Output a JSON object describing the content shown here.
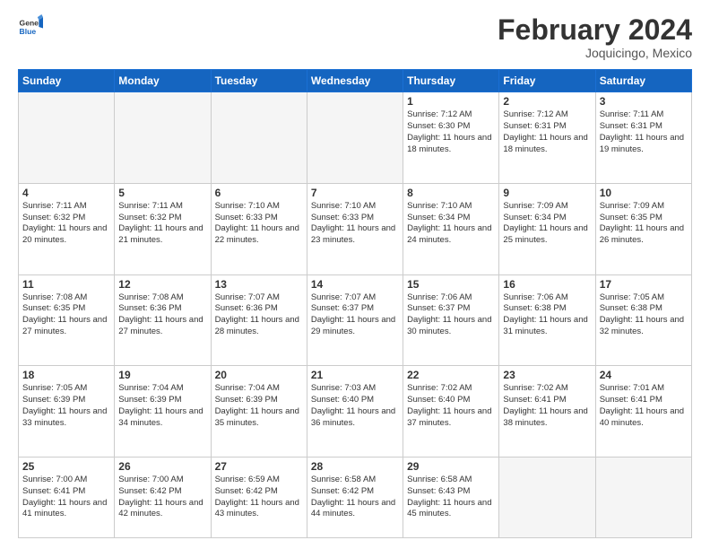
{
  "header": {
    "logo_general": "General",
    "logo_blue": "Blue",
    "month_title": "February 2024",
    "location": "Joquicingo, Mexico"
  },
  "days_of_week": [
    "Sunday",
    "Monday",
    "Tuesday",
    "Wednesday",
    "Thursday",
    "Friday",
    "Saturday"
  ],
  "weeks": [
    [
      {
        "day": "",
        "empty": true
      },
      {
        "day": "",
        "empty": true
      },
      {
        "day": "",
        "empty": true
      },
      {
        "day": "",
        "empty": true
      },
      {
        "day": "1",
        "sunrise": "7:12 AM",
        "sunset": "6:30 PM",
        "daylight": "11 hours and 18 minutes."
      },
      {
        "day": "2",
        "sunrise": "7:12 AM",
        "sunset": "6:31 PM",
        "daylight": "11 hours and 18 minutes."
      },
      {
        "day": "3",
        "sunrise": "7:11 AM",
        "sunset": "6:31 PM",
        "daylight": "11 hours and 19 minutes."
      }
    ],
    [
      {
        "day": "4",
        "sunrise": "7:11 AM",
        "sunset": "6:32 PM",
        "daylight": "11 hours and 20 minutes."
      },
      {
        "day": "5",
        "sunrise": "7:11 AM",
        "sunset": "6:32 PM",
        "daylight": "11 hours and 21 minutes."
      },
      {
        "day": "6",
        "sunrise": "7:10 AM",
        "sunset": "6:33 PM",
        "daylight": "11 hours and 22 minutes."
      },
      {
        "day": "7",
        "sunrise": "7:10 AM",
        "sunset": "6:33 PM",
        "daylight": "11 hours and 23 minutes."
      },
      {
        "day": "8",
        "sunrise": "7:10 AM",
        "sunset": "6:34 PM",
        "daylight": "11 hours and 24 minutes."
      },
      {
        "day": "9",
        "sunrise": "7:09 AM",
        "sunset": "6:34 PM",
        "daylight": "11 hours and 25 minutes."
      },
      {
        "day": "10",
        "sunrise": "7:09 AM",
        "sunset": "6:35 PM",
        "daylight": "11 hours and 26 minutes."
      }
    ],
    [
      {
        "day": "11",
        "sunrise": "7:08 AM",
        "sunset": "6:35 PM",
        "daylight": "11 hours and 27 minutes."
      },
      {
        "day": "12",
        "sunrise": "7:08 AM",
        "sunset": "6:36 PM",
        "daylight": "11 hours and 27 minutes."
      },
      {
        "day": "13",
        "sunrise": "7:07 AM",
        "sunset": "6:36 PM",
        "daylight": "11 hours and 28 minutes."
      },
      {
        "day": "14",
        "sunrise": "7:07 AM",
        "sunset": "6:37 PM",
        "daylight": "11 hours and 29 minutes."
      },
      {
        "day": "15",
        "sunrise": "7:06 AM",
        "sunset": "6:37 PM",
        "daylight": "11 hours and 30 minutes."
      },
      {
        "day": "16",
        "sunrise": "7:06 AM",
        "sunset": "6:38 PM",
        "daylight": "11 hours and 31 minutes."
      },
      {
        "day": "17",
        "sunrise": "7:05 AM",
        "sunset": "6:38 PM",
        "daylight": "11 hours and 32 minutes."
      }
    ],
    [
      {
        "day": "18",
        "sunrise": "7:05 AM",
        "sunset": "6:39 PM",
        "daylight": "11 hours and 33 minutes."
      },
      {
        "day": "19",
        "sunrise": "7:04 AM",
        "sunset": "6:39 PM",
        "daylight": "11 hours and 34 minutes."
      },
      {
        "day": "20",
        "sunrise": "7:04 AM",
        "sunset": "6:39 PM",
        "daylight": "11 hours and 35 minutes."
      },
      {
        "day": "21",
        "sunrise": "7:03 AM",
        "sunset": "6:40 PM",
        "daylight": "11 hours and 36 minutes."
      },
      {
        "day": "22",
        "sunrise": "7:02 AM",
        "sunset": "6:40 PM",
        "daylight": "11 hours and 37 minutes."
      },
      {
        "day": "23",
        "sunrise": "7:02 AM",
        "sunset": "6:41 PM",
        "daylight": "11 hours and 38 minutes."
      },
      {
        "day": "24",
        "sunrise": "7:01 AM",
        "sunset": "6:41 PM",
        "daylight": "11 hours and 40 minutes."
      }
    ],
    [
      {
        "day": "25",
        "sunrise": "7:00 AM",
        "sunset": "6:41 PM",
        "daylight": "11 hours and 41 minutes."
      },
      {
        "day": "26",
        "sunrise": "7:00 AM",
        "sunset": "6:42 PM",
        "daylight": "11 hours and 42 minutes."
      },
      {
        "day": "27",
        "sunrise": "6:59 AM",
        "sunset": "6:42 PM",
        "daylight": "11 hours and 43 minutes."
      },
      {
        "day": "28",
        "sunrise": "6:58 AM",
        "sunset": "6:42 PM",
        "daylight": "11 hours and 44 minutes."
      },
      {
        "day": "29",
        "sunrise": "6:58 AM",
        "sunset": "6:43 PM",
        "daylight": "11 hours and 45 minutes."
      },
      {
        "day": "",
        "empty": true
      },
      {
        "day": "",
        "empty": true
      }
    ]
  ],
  "labels": {
    "sunrise_prefix": "Sunrise: ",
    "sunset_prefix": "Sunset: ",
    "daylight_prefix": "Daylight: "
  }
}
